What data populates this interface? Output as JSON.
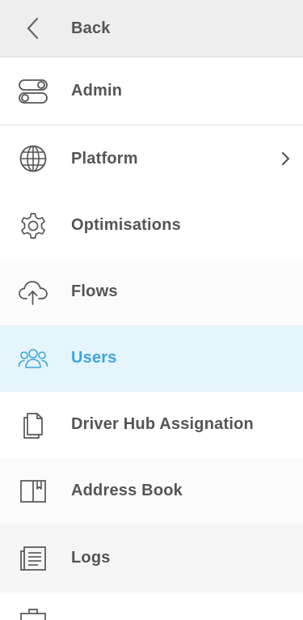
{
  "back": {
    "label": "Back",
    "icon": "chevron-left-icon"
  },
  "items": [
    {
      "label": "Admin",
      "icon": "toggles-icon"
    },
    {
      "label": "Platform",
      "icon": "globe-icon",
      "has_submenu": true
    },
    {
      "label": "Optimisations",
      "icon": "gear-icon"
    },
    {
      "label": "Flows",
      "icon": "cloud-upload-icon"
    },
    {
      "label": "Users",
      "icon": "users-icon",
      "active": true
    },
    {
      "label": "Driver Hub Assignation",
      "icon": "documents-icon"
    },
    {
      "label": "Address Book",
      "icon": "book-icon"
    },
    {
      "label": "Logs",
      "icon": "list-document-icon"
    },
    {
      "label": "",
      "icon": "briefcase-icon"
    }
  ],
  "colors": {
    "active": "#3aa6e0",
    "active_bg": "#e6f4fb",
    "text": "#555555",
    "header_bg": "#eeeeee"
  }
}
